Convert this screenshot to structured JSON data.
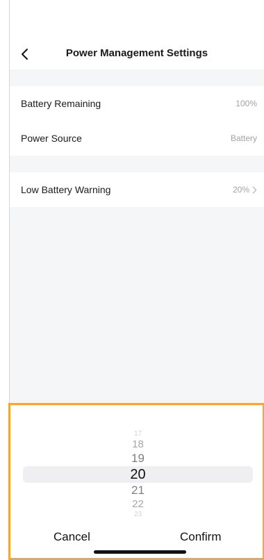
{
  "header": {
    "title": "Power Management Settings"
  },
  "status_group": [
    {
      "label": "Battery Remaining",
      "value": "100%"
    },
    {
      "label": "Power Source",
      "value": "Battery"
    }
  ],
  "warning_group": [
    {
      "label": "Low Battery Warning",
      "value": "20%"
    }
  ],
  "picker": {
    "items": [
      "17",
      "18",
      "19",
      "20",
      "21",
      "22",
      "23"
    ],
    "selected": "20"
  },
  "actions": {
    "cancel": "Cancel",
    "confirm": "Confirm"
  },
  "colors": {
    "highlight_border": "#f5a53a",
    "background": "#f5f6f8",
    "secondary_text": "#a3a3a3"
  },
  "icons": {
    "back": "chevron-left-icon",
    "row_arrow": "chevron-right-icon"
  }
}
